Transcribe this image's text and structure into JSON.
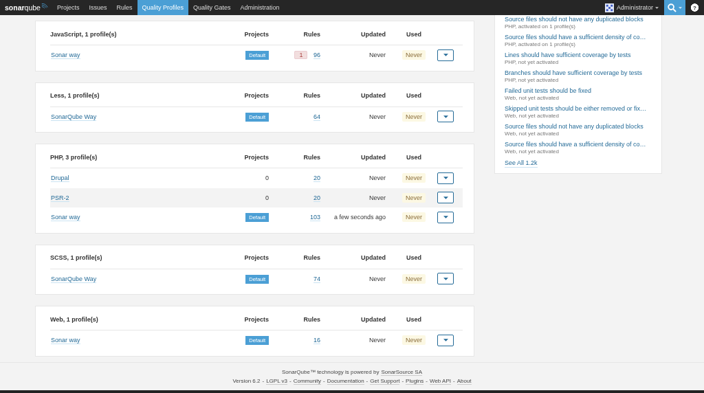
{
  "navbar": {
    "logo_prefix": "sonar",
    "logo_suffix": "qube",
    "items": [
      {
        "label": "Projects",
        "selected": false
      },
      {
        "label": "Issues",
        "selected": false
      },
      {
        "label": "Rules",
        "selected": false
      },
      {
        "label": "Quality Profiles",
        "selected": true
      },
      {
        "label": "Quality Gates",
        "selected": false
      },
      {
        "label": "Administration",
        "selected": false
      }
    ],
    "user": "Administrator",
    "help": "?"
  },
  "languages": [
    {
      "title": "JavaScript, 1 profile(s)",
      "columns": [
        "Projects",
        "Rules",
        "Updated",
        "Used"
      ],
      "rows": [
        {
          "name": "Sonar way",
          "projects": "Default",
          "kind": "badge",
          "inactive_rules": "1",
          "rules": "96",
          "updated": "Never",
          "used": "Never",
          "highlighted": false
        }
      ]
    },
    {
      "title": "Less, 1 profile(s)",
      "columns": [
        "Projects",
        "Rules",
        "Updated",
        "Used"
      ],
      "rows": [
        {
          "name": "SonarQube Way",
          "projects": "Default",
          "kind": "badge",
          "rules": "64",
          "updated": "Never",
          "used": "Never",
          "highlighted": false
        }
      ]
    },
    {
      "title": "PHP, 3 profile(s)",
      "columns": [
        "Projects",
        "Rules",
        "Updated",
        "Used"
      ],
      "rows": [
        {
          "name": "Drupal",
          "projects": "0",
          "kind": "count",
          "rules": "20",
          "updated": "Never",
          "used": "Never",
          "highlighted": false
        },
        {
          "name": "PSR-2",
          "projects": "0",
          "kind": "count",
          "rules": "20",
          "updated": "Never",
          "used": "Never",
          "highlighted": true
        },
        {
          "name": "Sonar way",
          "projects": "Default",
          "kind": "badge",
          "rules": "103",
          "updated": "a few seconds ago",
          "used": "Never",
          "highlighted": false
        }
      ]
    },
    {
      "title": "SCSS, 1 profile(s)",
      "columns": [
        "Projects",
        "Rules",
        "Updated",
        "Used"
      ],
      "rows": [
        {
          "name": "SonarQube Way",
          "projects": "Default",
          "kind": "badge",
          "rules": "74",
          "updated": "Never",
          "used": "Never",
          "highlighted": false
        }
      ]
    },
    {
      "title": "Web, 1 profile(s)",
      "columns": [
        "Projects",
        "Rules",
        "Updated",
        "Used"
      ],
      "rows": [
        {
          "name": "Sonar way",
          "projects": "Default",
          "kind": "badge",
          "rules": "16",
          "updated": "Never",
          "used": "Never",
          "highlighted": false
        }
      ]
    }
  ],
  "recent_rules": {
    "items": [
      {
        "title": "Source files should not have any duplicated blocks",
        "meta": "PHP, activated on 1 profile(s)"
      },
      {
        "title": "Source files should have a sufficient density of co…",
        "meta": "PHP, activated on 1 profile(s)"
      },
      {
        "title": "Lines should have sufficient coverage by tests",
        "meta": "PHP, not yet activated"
      },
      {
        "title": "Branches should have sufficient coverage by tests",
        "meta": "PHP, not yet activated"
      },
      {
        "title": "Failed unit tests should be fixed",
        "meta": "Web, not yet activated"
      },
      {
        "title": "Skipped unit tests should be either removed or fix…",
        "meta": "Web, not yet activated"
      },
      {
        "title": "Source files should not have any duplicated blocks",
        "meta": "Web, not yet activated"
      },
      {
        "title": "Source files should have a sufficient density of co…",
        "meta": "Web, not yet activated"
      }
    ],
    "see_all": "See All 1.2k"
  },
  "footer": {
    "line": "SonarQube™ technology is powered by",
    "company": "SonarSource SA",
    "version": "Version 6.2",
    "links": [
      "LGPL v3",
      "Community",
      "Documentation",
      "Get Support",
      "Plugins",
      "Web API",
      "About"
    ],
    "separator": "-"
  }
}
